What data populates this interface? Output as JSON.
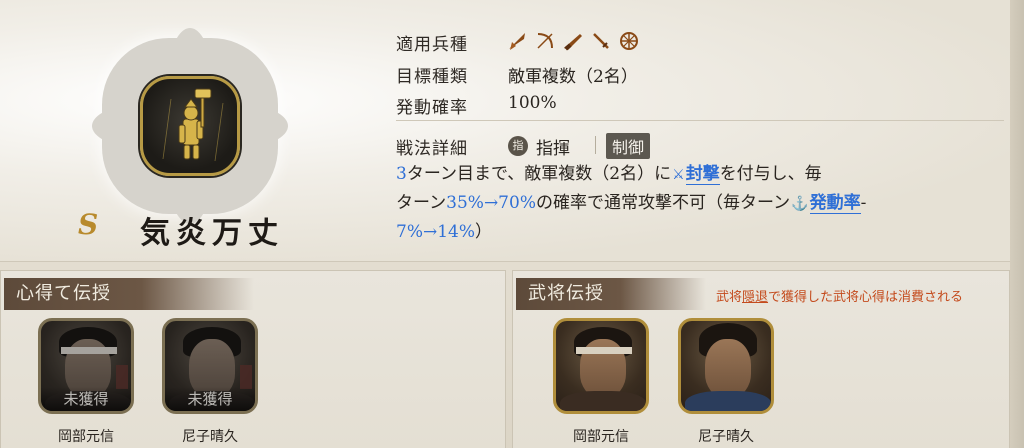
{
  "skill": {
    "grade": "S",
    "name": "気炎万丈",
    "icon": "golden-warrior-emblem"
  },
  "info": {
    "troop_label": "適用兵種",
    "troop_icons": [
      "spear-icon",
      "bow-icon",
      "gun-icon",
      "sword-icon",
      "siege-wheel-icon"
    ],
    "target_label": "目標種類",
    "target_value": "敵軍複数（2名）",
    "rate_label": "発動確率",
    "rate_value": "100%",
    "detail_label": "戦法詳細",
    "badge_glyph": "指",
    "type_label": "指揮",
    "category_label": "制御"
  },
  "description": {
    "p1": "3",
    "p2": "ターン目まで、敵軍複数（2名）に",
    "link1": "封撃",
    "p3": "を付与し、毎",
    "p4": "ターン",
    "p5": "35%→70%",
    "p6": "の確率で通常攻撃不可（毎ターン",
    "link2": "発動率",
    "p7": "-",
    "p8": "7%→14%",
    "p9": "）"
  },
  "left_panel": {
    "title": "心得て伝授",
    "commanders": [
      {
        "name": "岡部元信",
        "status": "未獲得"
      },
      {
        "name": "尼子晴久",
        "status": "未獲得"
      }
    ]
  },
  "right_panel": {
    "title": "武将伝授",
    "note_pre": "武将",
    "note_link": "隠退",
    "note_post": "で獲得した武将心得は消費される",
    "commanders": [
      {
        "name": "岡部元信"
      },
      {
        "name": "尼子晴久"
      }
    ]
  },
  "colors": {
    "accent_blue": "#2f6fd6",
    "note_red": "#c44b1d",
    "frame_gold": "#b08e3b",
    "header_brown": "#5d4a3a"
  }
}
